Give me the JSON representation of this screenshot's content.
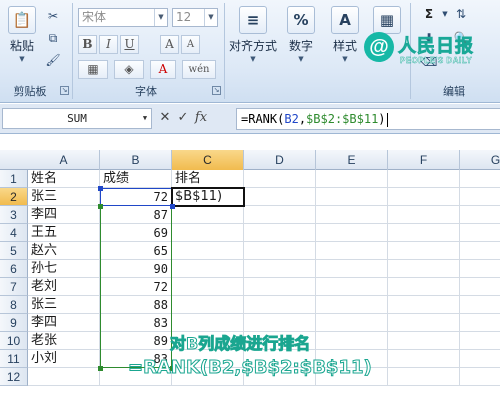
{
  "ribbon": {
    "clipboard": {
      "paste_label": "粘贴",
      "group_label": "剪贴板"
    },
    "font": {
      "font_name_placeholder": "宋体",
      "font_size_placeholder": "12",
      "bold": "B",
      "italic": "I",
      "underline": "U",
      "grow": "A",
      "shrink": "A",
      "font_color": "A",
      "phonetic": "wén",
      "group_label": "字体"
    },
    "alignment": {
      "label": "对齐方式"
    },
    "number": {
      "label": "数字",
      "icon_text": "%"
    },
    "styles": {
      "label": "样式",
      "icon_text": "A"
    },
    "cells": {
      "icon_text": "▦"
    },
    "editing": {
      "group_label": "编辑",
      "sum_icon": "Σ"
    }
  },
  "logo": {
    "mark": "@",
    "name": "人民日报",
    "sub": "PEOPLE'S DAILY"
  },
  "formula_bar": {
    "name_box": "SUM",
    "cancel": "✕",
    "enter": "✓",
    "fx": "fx",
    "formula_prefix": "=RANK(",
    "formula_ref1": "B2",
    "formula_sep": ",",
    "formula_ref2": "$B$2:$B$11",
    "formula_suffix": ")"
  },
  "sheet": {
    "columns": [
      "A",
      "B",
      "C",
      "D",
      "E",
      "F",
      "G"
    ],
    "active_column": "C",
    "active_row": 2,
    "rows": [
      {
        "n": "1",
        "a": "姓名",
        "b": "成绩",
        "c": "排名"
      },
      {
        "n": "2",
        "a": "张三",
        "b": "72",
        "c": "$B$11)"
      },
      {
        "n": "3",
        "a": "李四",
        "b": "87",
        "c": ""
      },
      {
        "n": "4",
        "a": "王五",
        "b": "69",
        "c": ""
      },
      {
        "n": "5",
        "a": "赵六",
        "b": "65",
        "c": ""
      },
      {
        "n": "6",
        "a": "孙七",
        "b": "90",
        "c": ""
      },
      {
        "n": "7",
        "a": "老刘",
        "b": "72",
        "c": ""
      },
      {
        "n": "8",
        "a": "张三",
        "b": "88",
        "c": ""
      },
      {
        "n": "9",
        "a": "李四",
        "b": "83",
        "c": ""
      },
      {
        "n": "10",
        "a": "老张",
        "b": "89",
        "c": ""
      },
      {
        "n": "11",
        "a": "小刘",
        "b": "83",
        "c": ""
      },
      {
        "n": "12",
        "a": "",
        "b": "",
        "c": ""
      }
    ]
  },
  "overlay": {
    "line1": "对B列成绩进行排名",
    "line2": "=RANK(B2,$B$2:$B$11)"
  },
  "colors": {
    "ref_b2": "#2047c8",
    "ref_abs": "#2e8b2e",
    "overlay_outline": "#1aa690",
    "logo": "#17b8a6"
  }
}
